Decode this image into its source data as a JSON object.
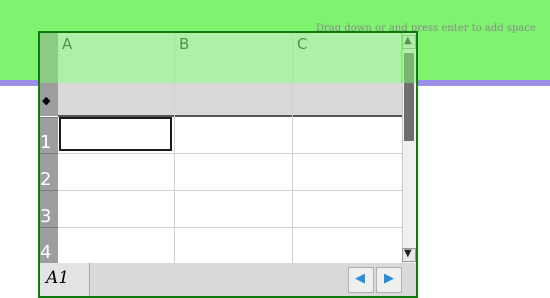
{
  "banner": {
    "hint_text": "Drag down or and press enter to add space"
  },
  "sheet": {
    "columns": [
      "A",
      "B",
      "C"
    ],
    "formula_row_marker": "◆",
    "rows": [
      "1",
      "2",
      "3",
      "4"
    ],
    "name_box": "A1"
  },
  "icons": {
    "scroll_up": "▲",
    "scroll_down": "▼",
    "nav_prev": "◀",
    "nav_next": "▶"
  },
  "colors": {
    "banner": "#7ff26f",
    "banner_line": "#9b8ee8",
    "header_bg": "#9e9e9e",
    "nav_arrow": "#2b8fd6"
  }
}
